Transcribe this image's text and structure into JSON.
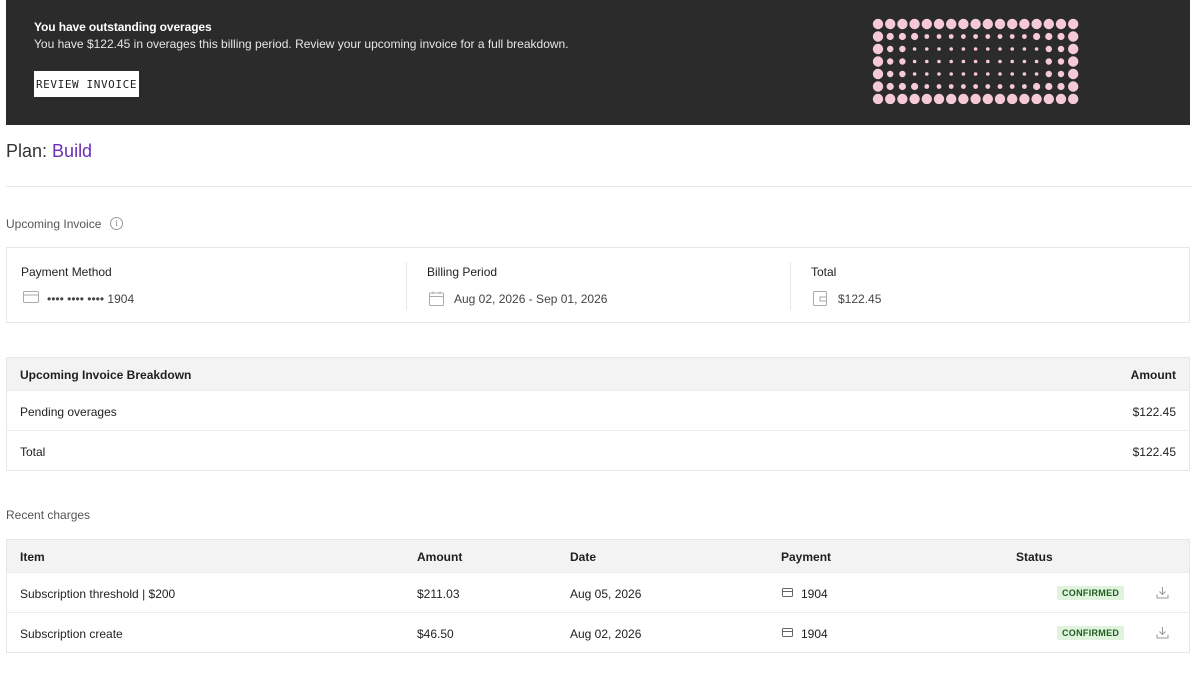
{
  "banner": {
    "title": "You have outstanding overages",
    "text": "You have $122.45 in overages this billing period. Review your upcoming invoice for a full breakdown.",
    "button_label": "REVIEW INVOICE",
    "pattern_color": "#f6c9d6"
  },
  "plan": {
    "prefix": "Plan:",
    "name": "Build",
    "name_color": "#6b2fb3"
  },
  "upcoming": {
    "label": "Upcoming Invoice",
    "info_icon": "info-icon",
    "payment_method": {
      "label": "Payment Method",
      "value": "•••• •••• •••• 1904",
      "icon": "credit-card-icon"
    },
    "billing_period": {
      "label": "Billing Period",
      "value": "Aug 02, 2026 - Sep 01, 2026",
      "icon": "calendar-icon"
    },
    "total": {
      "label": "Total",
      "value": "$122.45",
      "icon": "receipt-icon"
    }
  },
  "breakdown": {
    "header": {
      "item": "Upcoming Invoice Breakdown",
      "amount": "Amount"
    },
    "rows": [
      {
        "item": "Pending overages",
        "amount": "$122.45"
      },
      {
        "item": "Total",
        "amount": "$122.45"
      }
    ]
  },
  "charges": {
    "label": "Recent charges",
    "columns": {
      "item": "Item",
      "amount": "Amount",
      "date": "Date",
      "payment": "Payment",
      "status": "Status"
    },
    "rows": [
      {
        "item": "Subscription threshold | $200",
        "amount": "$211.03",
        "date": "Aug 05, 2026",
        "payment": "1904",
        "status": "CONFIRMED"
      },
      {
        "item": "Subscription create",
        "amount": "$46.50",
        "date": "Aug 02, 2026",
        "payment": "1904",
        "status": "CONFIRMED"
      }
    ],
    "status_color": "#dff3dd"
  }
}
